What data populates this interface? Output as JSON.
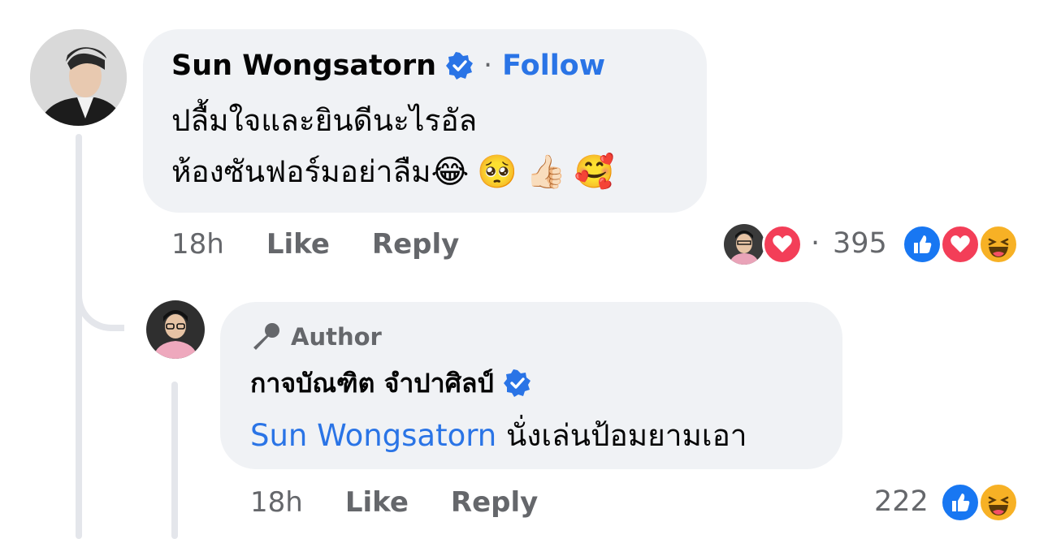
{
  "comment": {
    "author_name": "Sun Wongsatorn",
    "follow_label": "Follow",
    "separator": "·",
    "text_line1": "ปลื้มใจและยินดีนะไรอัล",
    "text_line2": "ห้องซันฟอร์มอย่าลืม",
    "emojis": [
      "😂",
      "🥺",
      "👍🏻",
      "🥰"
    ],
    "time": "18h",
    "like_label": "Like",
    "reply_label": "Reply",
    "reaction_separator": "·",
    "reaction_count": "395",
    "reactions": [
      "like",
      "love",
      "haha"
    ]
  },
  "reply": {
    "badge_label": "Author",
    "author_name": "กาจบัณฑิต จำปาศิลป์",
    "mention": "Sun Wongsatorn",
    "text": " นั่งเล่นป้อมยามเอา",
    "time": "18h",
    "like_label": "Like",
    "reply_label": "Reply",
    "reaction_count": "222",
    "reactions": [
      "like",
      "haha"
    ]
  },
  "colors": {
    "accent": "#2a74e6",
    "bubble": "#f0f2f5",
    "muted": "#65676b",
    "like": "#1877f2",
    "love": "#f33e58",
    "haha": "#f7b125"
  }
}
